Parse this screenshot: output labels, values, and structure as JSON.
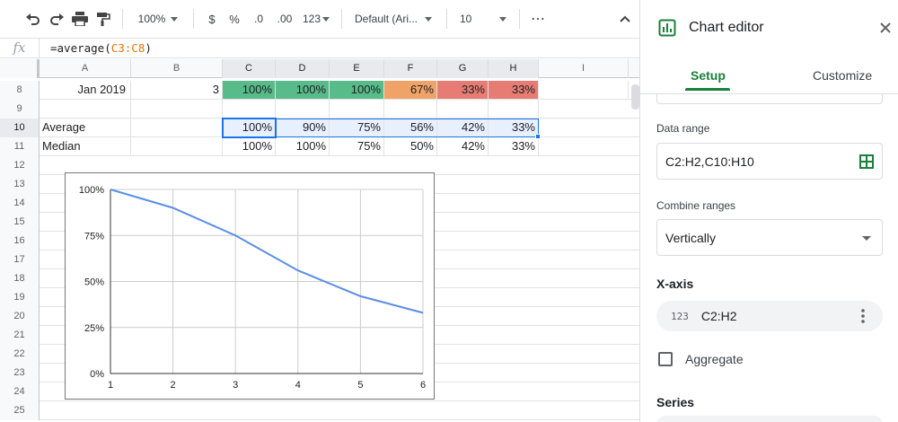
{
  "toolbar": {
    "zoom": "100%",
    "currency": "$",
    "percent": "%",
    "decrease_decimal": ".0",
    "increase_decimal": ".00",
    "format_more": "123",
    "font": "Default (Ari...",
    "font_size": "10",
    "more": "⋯",
    "collapse": "︿"
  },
  "formula_bar": {
    "fx": "fx",
    "prefix": "=average(",
    "ref": "C3:C8",
    "suffix": ")"
  },
  "columns": [
    "A",
    "B",
    "C",
    "D",
    "E",
    "F",
    "G",
    "H",
    "I"
  ],
  "rows": {
    "r8": {
      "num": "8",
      "a": "Jan 2019",
      "b": "3",
      "c": "100%",
      "d": "100%",
      "e": "100%",
      "f": "67%",
      "g": "33%",
      "h": "33%"
    },
    "r9": {
      "num": "9"
    },
    "r10": {
      "num": "10",
      "a": "Average",
      "c": "100%",
      "d": "90%",
      "e": "75%",
      "f": "56%",
      "g": "42%",
      "h": "33%"
    },
    "r11": {
      "num": "11",
      "a": "Median",
      "c": "100%",
      "d": "100%",
      "e": "75%",
      "f": "50%",
      "g": "42%",
      "h": "33%"
    },
    "empty_rows": [
      "12",
      "13",
      "14",
      "15",
      "16",
      "17",
      "18",
      "19",
      "20",
      "21",
      "22",
      "23",
      "24",
      "25"
    ]
  },
  "colors": {
    "green": "#57bb8a",
    "orange": "#f0a366",
    "red": "#e67c73",
    "selection": "#1a73e8",
    "line": "#5b8ee6",
    "accent": "#188038"
  },
  "chart_data": {
    "type": "line",
    "x": [
      1,
      2,
      3,
      4,
      5,
      6
    ],
    "series": [
      {
        "values": [
          1.0,
          0.9,
          0.75,
          0.56,
          0.42,
          0.33
        ]
      }
    ],
    "y_ticks": [
      "0%",
      "25%",
      "50%",
      "75%",
      "100%"
    ],
    "x_ticks": [
      "1",
      "2",
      "3",
      "4",
      "5",
      "6"
    ],
    "ylim": [
      0,
      1
    ],
    "xlim": [
      1,
      6
    ],
    "grid": true,
    "title": "",
    "xlabel": "",
    "ylabel": ""
  },
  "panel": {
    "title": "Chart editor",
    "tabs": {
      "setup": "Setup",
      "customize": "Customize"
    },
    "data_range_label": "Data range",
    "data_range_value": "C2:H2,C10:H10",
    "combine_label": "Combine ranges",
    "combine_value": "Vertically",
    "xaxis_title": "X-axis",
    "xaxis_chip_icon": "123",
    "xaxis_chip_value": "C2:H2",
    "aggregate_label": "Aggregate",
    "series_title": "Series",
    "icons": {
      "chart": "chart-icon",
      "close": "close-icon",
      "grid": "grid-select-icon",
      "kebab": "more-vert-icon"
    }
  }
}
